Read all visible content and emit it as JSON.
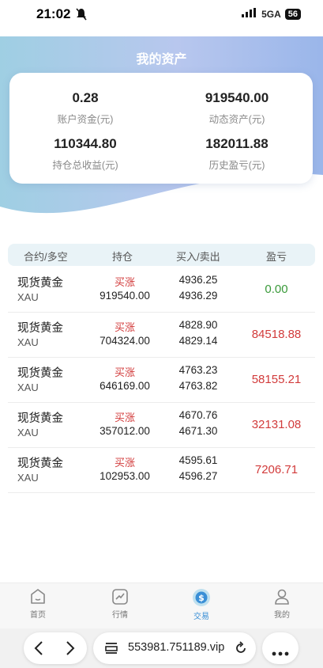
{
  "status_bar": {
    "time": "21:02",
    "network": "5GA",
    "battery": "56"
  },
  "header": {
    "title": "我的资产"
  },
  "assets": {
    "account_funds": {
      "value": "0.28",
      "label": "账户资金(元)"
    },
    "dynamic_assets": {
      "value": "919540.00",
      "label": "动态资产(元)"
    },
    "holding_profit": {
      "value": "110344.80",
      "label": "持仓总收益(元)"
    },
    "history_pnl": {
      "value": "182011.88",
      "label": "历史盈亏(元)"
    }
  },
  "table": {
    "headers": [
      "合约/多空",
      "持仓",
      "买入/卖出",
      "盈亏"
    ],
    "rows": [
      {
        "name": "现货黄金",
        "code": "XAU",
        "direction": "买涨",
        "position": "919540.00",
        "buy": "4936.25",
        "sell": "4936.29",
        "pnl": "0.00",
        "pnl_color": "#3a9a3a"
      },
      {
        "name": "现货黄金",
        "code": "XAU",
        "direction": "买涨",
        "position": "704324.00",
        "buy": "4828.90",
        "sell": "4829.14",
        "pnl": "84518.88",
        "pnl_color": "#d23b3b"
      },
      {
        "name": "现货黄金",
        "code": "XAU",
        "direction": "买涨",
        "position": "646169.00",
        "buy": "4763.23",
        "sell": "4763.82",
        "pnl": "58155.21",
        "pnl_color": "#d23b3b"
      },
      {
        "name": "现货黄金",
        "code": "XAU",
        "direction": "买涨",
        "position": "357012.00",
        "buy": "4670.76",
        "sell": "4671.30",
        "pnl": "32131.08",
        "pnl_color": "#d23b3b"
      },
      {
        "name": "现货黄金",
        "code": "XAU",
        "direction": "买涨",
        "position": "102953.00",
        "buy": "4595.61",
        "sell": "4596.27",
        "pnl": "7206.71",
        "pnl_color": "#d23b3b"
      }
    ]
  },
  "nav": {
    "items": [
      {
        "label": "首页",
        "icon": "home-icon"
      },
      {
        "label": "行情",
        "icon": "chart-icon"
      },
      {
        "label": "交易",
        "icon": "dollar-icon",
        "active": true
      },
      {
        "label": "我的",
        "icon": "user-icon"
      }
    ]
  },
  "browser": {
    "url": "553981.751189.vip"
  }
}
